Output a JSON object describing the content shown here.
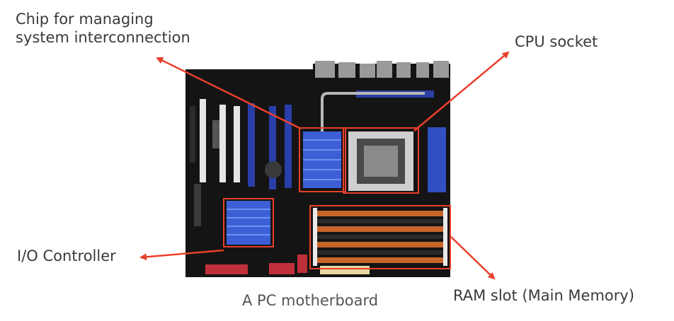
{
  "labels": {
    "chip_line1": "Chip for managing",
    "chip_line2": "system interconnection",
    "cpu": "CPU socket",
    "io": "I/O Controller",
    "ram": "RAM slot (Main Memory)",
    "caption": "A PC motherboard"
  },
  "colors": {
    "annotation": "#e8402a",
    "text": "#3a3a3a",
    "board": "#141414",
    "heatsink_blue": "#3d5fd6",
    "pcie_blue": "#2a3ea8",
    "ram_orange": "#c8642a"
  }
}
